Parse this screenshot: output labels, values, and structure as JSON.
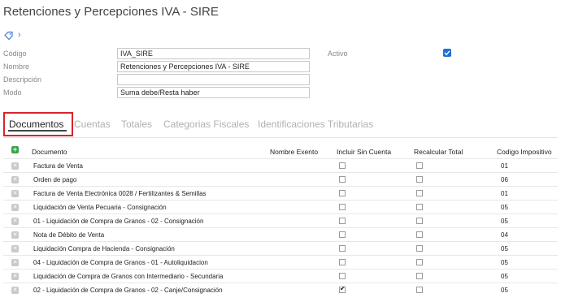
{
  "header": {
    "title": "Retenciones y Percepciones IVA - SIRE"
  },
  "form": {
    "codigo": {
      "label": "Código",
      "value": "IVA_SIRE"
    },
    "nombre": {
      "label": "Nombre",
      "value": "Retenciones y Percepciones IVA - SIRE"
    },
    "descripcion": {
      "label": "Descripción",
      "value": ""
    },
    "modo": {
      "label": "Modo",
      "value": "Suma debe/Resta haber"
    },
    "activo": {
      "label": "Activo",
      "checked": true
    }
  },
  "tabs": [
    {
      "label": "Documentos",
      "active": true
    },
    {
      "label": "Cuentas"
    },
    {
      "label": "Totales"
    },
    {
      "label": "Categorias Fiscales"
    },
    {
      "label": "Identificaciones Tributarias"
    }
  ],
  "grid": {
    "columns": {
      "documento": "Documento",
      "nombre_exento": "Nombre Exento",
      "incluir_sin_cuenta": "Incluir Sin Cuenta",
      "recalcular_total": "Recalcular Total",
      "codigo_impositivo": "Codigo Impositivo"
    },
    "rows": [
      {
        "documento": "Factura de Venta",
        "incluir_sin_cuenta": false,
        "recalcular_total": false,
        "codigo_impositivo": "01"
      },
      {
        "documento": "Orden de pago",
        "incluir_sin_cuenta": false,
        "recalcular_total": false,
        "codigo_impositivo": "06"
      },
      {
        "documento": "Factura de Venta Electrónica 0028 / Fertilizantes & Semillas",
        "incluir_sin_cuenta": false,
        "recalcular_total": false,
        "codigo_impositivo": "01"
      },
      {
        "documento": "Liquidación de Venta Pecuaria - Consignación",
        "incluir_sin_cuenta": false,
        "recalcular_total": false,
        "codigo_impositivo": "05"
      },
      {
        "documento": "01 - Liquidación de Compra de Granos - 02 - Consignación",
        "incluir_sin_cuenta": false,
        "recalcular_total": false,
        "codigo_impositivo": "05"
      },
      {
        "documento": "Nota de Débito de Venta",
        "incluir_sin_cuenta": false,
        "recalcular_total": false,
        "codigo_impositivo": "04"
      },
      {
        "documento": "Liquidación Compra de Hacienda - Consignación",
        "incluir_sin_cuenta": false,
        "recalcular_total": false,
        "codigo_impositivo": "05"
      },
      {
        "documento": "04 - Liquidación de Compra de Granos - 01 - Autoliquidacion",
        "incluir_sin_cuenta": false,
        "recalcular_total": false,
        "codigo_impositivo": "05"
      },
      {
        "documento": "Liquidación de Compra de Granos con Intermediario - Secundaria",
        "incluir_sin_cuenta": false,
        "recalcular_total": false,
        "codigo_impositivo": "05"
      },
      {
        "documento": "02 - Liquidación de Compra de Granos - 02 - Canje/Consignación",
        "incluir_sin_cuenta": true,
        "recalcular_total": false,
        "codigo_impositivo": "05"
      }
    ]
  },
  "icons": {
    "tag": "tag-icon",
    "expand": "chevron-right-icon",
    "add": "add-row-icon",
    "delete": "delete-row-icon"
  },
  "colors": {
    "accent": "#1f6fd6",
    "highlight": "#d8232a",
    "add": "#3aa34a"
  }
}
